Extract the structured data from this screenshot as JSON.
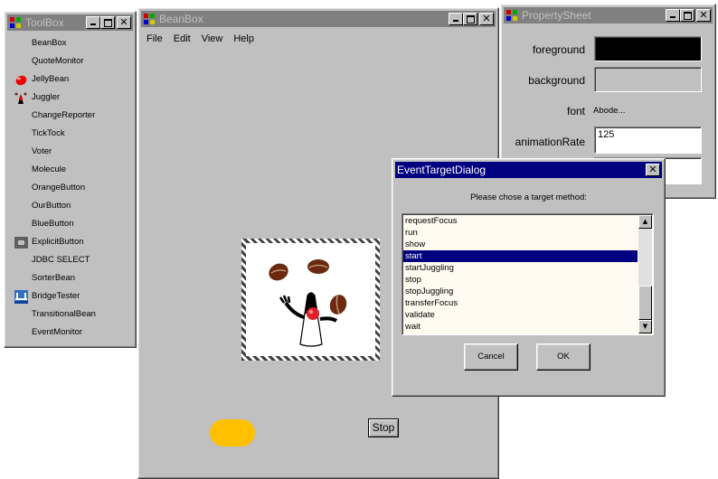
{
  "toolbox": {
    "title": "ToolBox",
    "items": [
      {
        "label": "BeanBox",
        "icon": ""
      },
      {
        "label": "QuoteMonitor",
        "icon": ""
      },
      {
        "label": "JellyBean",
        "icon": "red-jellybean-icon"
      },
      {
        "label": "Juggler",
        "icon": "duke-juggler-icon"
      },
      {
        "label": "ChangeReporter",
        "icon": ""
      },
      {
        "label": "TickTock",
        "icon": ""
      },
      {
        "label": "Voter",
        "icon": ""
      },
      {
        "label": "Molecule",
        "icon": ""
      },
      {
        "label": "OrangeButton",
        "icon": ""
      },
      {
        "label": "OurButton",
        "icon": ""
      },
      {
        "label": "BlueButton",
        "icon": ""
      },
      {
        "label": "ExplicitButton",
        "icon": "button-icon"
      },
      {
        "label": "JDBC SELECT",
        "icon": ""
      },
      {
        "label": "SorterBean",
        "icon": ""
      },
      {
        "label": "BridgeTester",
        "icon": "bridge-icon"
      },
      {
        "label": "TransitionalBean",
        "icon": ""
      },
      {
        "label": "EventMonitor",
        "icon": ""
      }
    ]
  },
  "beanbox": {
    "title": "BeanBox",
    "menu": [
      "File",
      "Edit",
      "View",
      "Help"
    ],
    "stop_label": "Stop",
    "orange_button_color": "#ffc000"
  },
  "propertysheet": {
    "title": "PropertySheet",
    "rows": {
      "foreground": {
        "label": "foreground",
        "color": "#000000"
      },
      "background": {
        "label": "background",
        "color": "#c0c0c0"
      },
      "font": {
        "label": "font",
        "value": "Abode..."
      },
      "animationRate": {
        "label": "animationRate",
        "value": "125"
      }
    }
  },
  "dialog": {
    "title": "EventTargetDialog",
    "prompt": "Please chose a target method:",
    "methods": [
      "requestFocus",
      "run",
      "show",
      "start",
      "startJuggling",
      "stop",
      "stopJuggling",
      "transferFocus",
      "validate",
      "wait"
    ],
    "selected": "start",
    "cancel_label": "Cancel",
    "ok_label": "OK"
  },
  "colors": {
    "window": "#c0c0c0",
    "active_title": "#000080",
    "inactive_title": "#808080",
    "list_bg": "#fffbf0"
  }
}
